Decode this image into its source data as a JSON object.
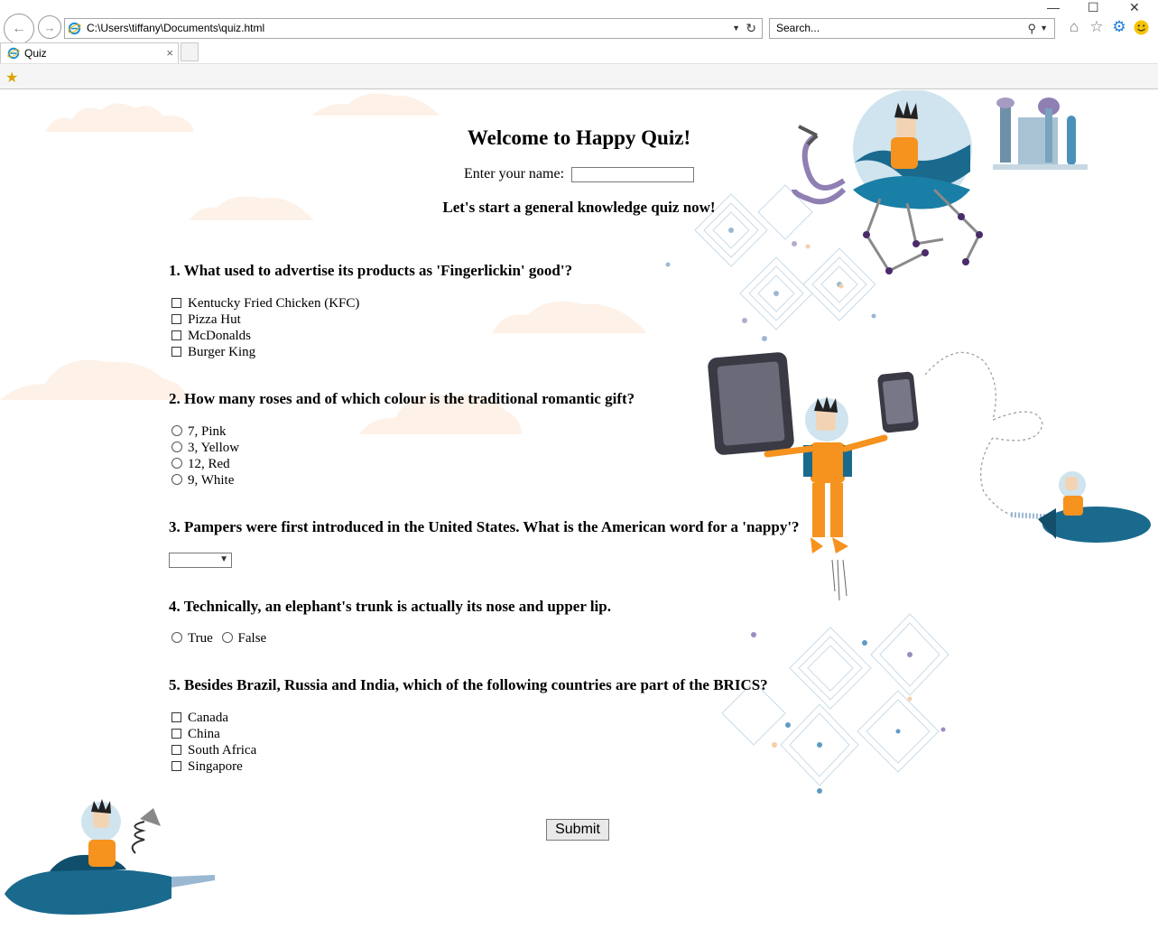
{
  "browser": {
    "address": "C:\\Users\\tiffany\\Documents\\quiz.html",
    "search_placeholder": "Search...",
    "tab_title": "Quiz",
    "tab_close": "×"
  },
  "page": {
    "title": "Welcome to Happy Quiz!",
    "name_label": "Enter your name:",
    "name_value": "",
    "intro": "Let's start a general knowledge quiz now!",
    "questions": [
      {
        "text": "1. What used to advertise its products as 'Fingerlickin' good'?",
        "type": "checkbox",
        "options": [
          "Kentucky Fried Chicken (KFC)",
          "Pizza Hut",
          "McDonalds",
          "Burger King"
        ]
      },
      {
        "text": "2. How many roses and of which colour is the traditional romantic gift?",
        "type": "radio",
        "options": [
          "7, Pink",
          "3, Yellow",
          "12, Red",
          "9, White"
        ]
      },
      {
        "text": "3. Pampers were first introduced in the United States. What is the American word for a 'nappy'?",
        "type": "select",
        "selected": ""
      },
      {
        "text": "4. Technically, an elephant's trunk is actually its nose and upper lip.",
        "type": "radio-inline",
        "options": [
          "True",
          "False"
        ]
      },
      {
        "text": "5. Besides Brazil, Russia and India, which of the following countries are part of the BRICS?",
        "type": "checkbox",
        "options": [
          "Canada",
          "China",
          "South Africa",
          "Singapore"
        ]
      }
    ],
    "submit_label": "Submit"
  },
  "icons": {
    "back": "back-arrow-icon",
    "forward": "forward-arrow-icon",
    "refresh": "refresh-icon",
    "search": "search-icon",
    "home": "home-icon",
    "favorites": "star-icon",
    "settings": "gear-icon",
    "feedback": "smiley-icon"
  },
  "colors": {
    "cloud": "#fdf1e8",
    "rocket": "#1a6a8e",
    "astronaut_suit": "#f6921e"
  }
}
